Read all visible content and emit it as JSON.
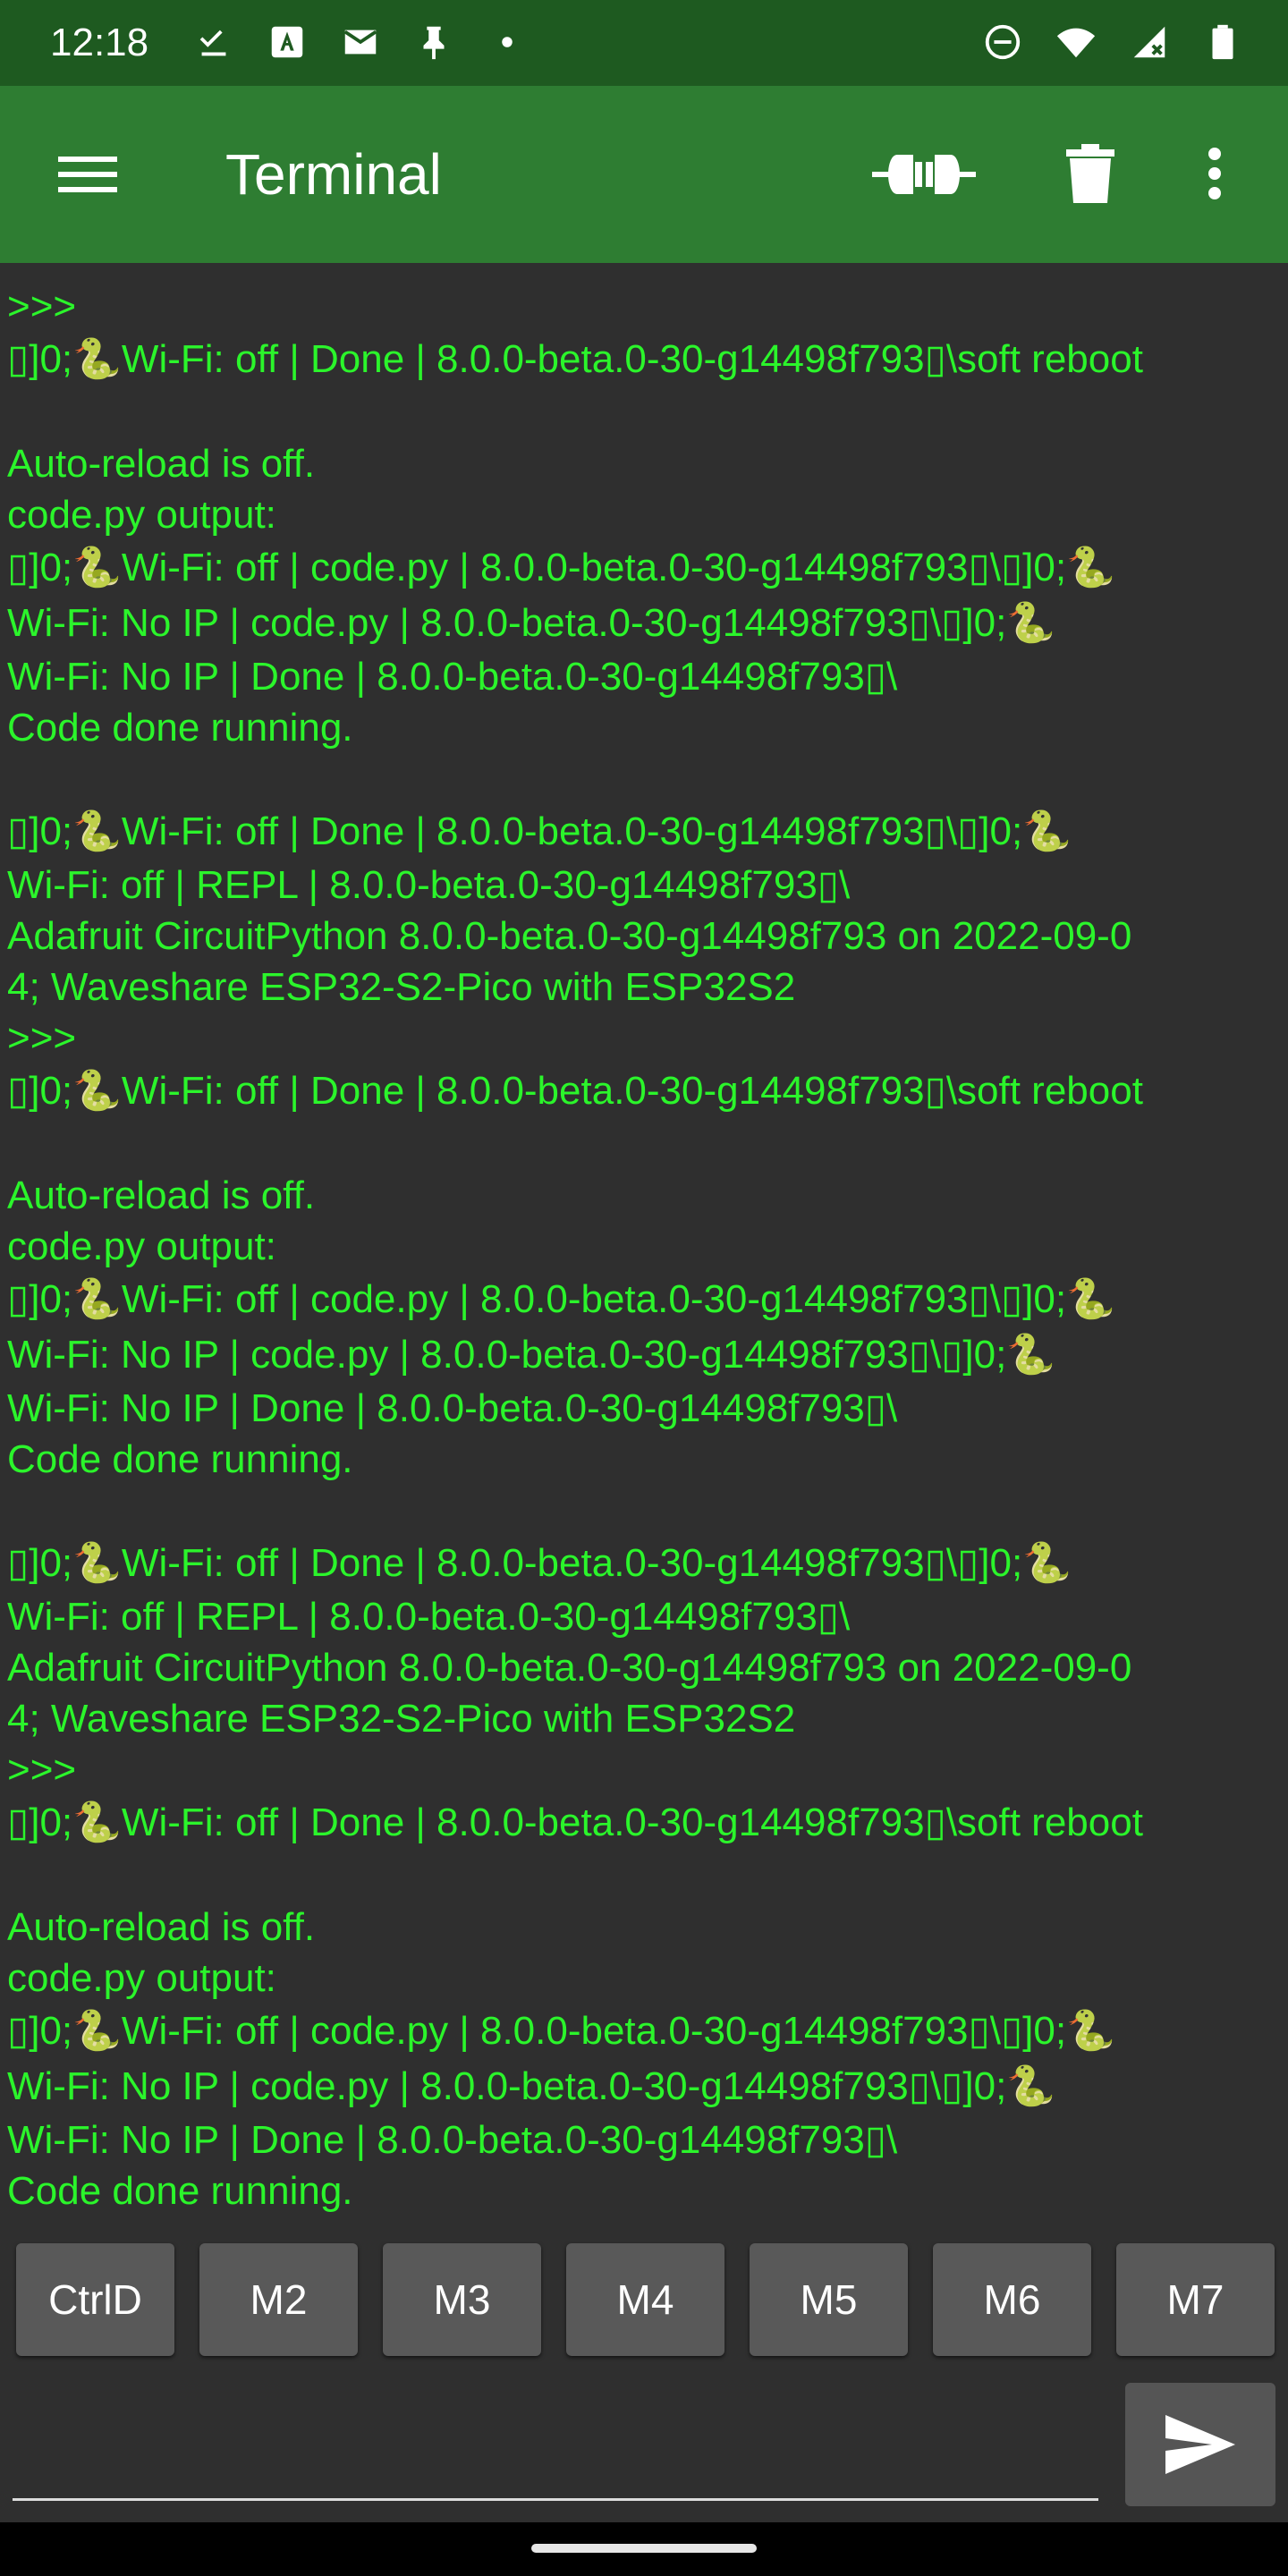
{
  "status_bar": {
    "time": "12:18",
    "left_icons": [
      "download-done-icon",
      "font-icon",
      "mail-icon",
      "pin-icon",
      "dot-icon"
    ],
    "right_icons": [
      "do-not-disturb-icon",
      "wifi-icon",
      "signal-icon",
      "battery-icon"
    ]
  },
  "app_bar": {
    "title": "Terminal",
    "background": "#2e7d32"
  },
  "terminal": {
    "text_color": "#2bf52b",
    "lines": [
      ">>>",
      "▯]0;🐍Wi-Fi: off | Done | 8.0.0-beta.0-30-g14498f793▯\\soft reboot",
      "",
      "Auto-reload is off.",
      "code.py output:",
      "▯]0;🐍Wi-Fi: off | code.py | 8.0.0-beta.0-30-g14498f793▯\\▯]0;🐍",
      "Wi-Fi: No IP | code.py | 8.0.0-beta.0-30-g14498f793▯\\▯]0;🐍",
      "Wi-Fi: No IP | Done | 8.0.0-beta.0-30-g14498f793▯\\",
      "Code done running.",
      "",
      "▯]0;🐍Wi-Fi: off | Done | 8.0.0-beta.0-30-g14498f793▯\\▯]0;🐍",
      "Wi-Fi: off | REPL | 8.0.0-beta.0-30-g14498f793▯\\",
      "Adafruit CircuitPython 8.0.0-beta.0-30-g14498f793 on 2022-09-0",
      "4; Waveshare ESP32-S2-Pico with ESP32S2",
      ">>>",
      "▯]0;🐍Wi-Fi: off | Done | 8.0.0-beta.0-30-g14498f793▯\\soft reboot",
      "",
      "Auto-reload is off.",
      "code.py output:",
      "▯]0;🐍Wi-Fi: off | code.py | 8.0.0-beta.0-30-g14498f793▯\\▯]0;🐍",
      "Wi-Fi: No IP | code.py | 8.0.0-beta.0-30-g14498f793▯\\▯]0;🐍",
      "Wi-Fi: No IP | Done | 8.0.0-beta.0-30-g14498f793▯\\",
      "Code done running.",
      "",
      "▯]0;🐍Wi-Fi: off | Done | 8.0.0-beta.0-30-g14498f793▯\\▯]0;🐍",
      "Wi-Fi: off | REPL | 8.0.0-beta.0-30-g14498f793▯\\",
      "Adafruit CircuitPython 8.0.0-beta.0-30-g14498f793 on 2022-09-0",
      "4; Waveshare ESP32-S2-Pico with ESP32S2",
      ">>>",
      "▯]0;🐍Wi-Fi: off | Done | 8.0.0-beta.0-30-g14498f793▯\\soft reboot",
      "",
      "Auto-reload is off.",
      "code.py output:",
      "▯]0;🐍Wi-Fi: off | code.py | 8.0.0-beta.0-30-g14498f793▯\\▯]0;🐍",
      "Wi-Fi: No IP | code.py | 8.0.0-beta.0-30-g14498f793▯\\▯]0;🐍",
      "Wi-Fi: No IP | Done | 8.0.0-beta.0-30-g14498f793▯\\",
      "Code done running."
    ]
  },
  "macros": [
    "CtrlD",
    "M2",
    "M3",
    "M4",
    "M5",
    "M6",
    "M7"
  ],
  "input": {
    "value": "",
    "placeholder": ""
  }
}
